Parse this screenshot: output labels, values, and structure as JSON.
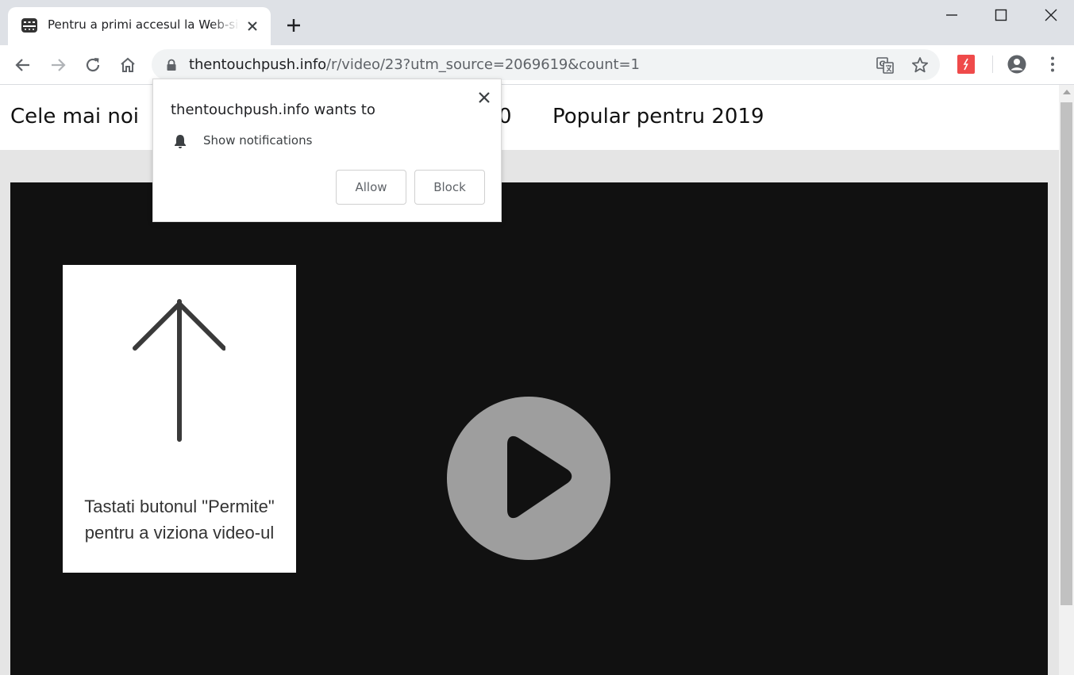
{
  "browser": {
    "tab": {
      "title": "Pentru a primi accesul la Web-site"
    },
    "address_bar": {
      "domain": "thentouchpush.info",
      "path": "/r/video/23?utm_source=2069619&count=1"
    }
  },
  "page": {
    "nav": {
      "items": [
        "Cele mai noi",
        "0",
        "Popular pentru 2019"
      ]
    },
    "hint": {
      "line1": "Tastati butonul \"Permite\"",
      "line2": "pentru a viziona video-ul"
    }
  },
  "permission_popup": {
    "title": "thentouchpush.info wants to",
    "permission": "Show notifications",
    "allow_label": "Allow",
    "block_label": "Block"
  },
  "colors": {
    "tabstrip": "#dee1e6",
    "video_bg": "#111111",
    "play_button": "#9e9e9e",
    "extension_icon": "#ef4a4a"
  }
}
